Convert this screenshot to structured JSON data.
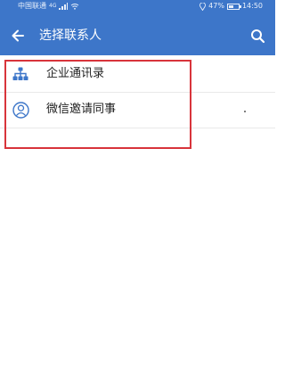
{
  "status_bar": {
    "carrier": "中国联通",
    "network_tag": "4G",
    "battery": "47%",
    "time": "14:50"
  },
  "header": {
    "title": "选择联系人",
    "back_icon": "arrow-left-icon",
    "search_icon": "search-icon"
  },
  "list": {
    "items": [
      {
        "label": "企业通讯录",
        "icon": "org-chart-icon"
      },
      {
        "label": "微信邀请同事",
        "icon": "person-circle-icon"
      }
    ]
  },
  "colors": {
    "header_bg": "#3d76c9",
    "icon_blue": "#3d76c9",
    "highlight_red": "#d8343b"
  }
}
